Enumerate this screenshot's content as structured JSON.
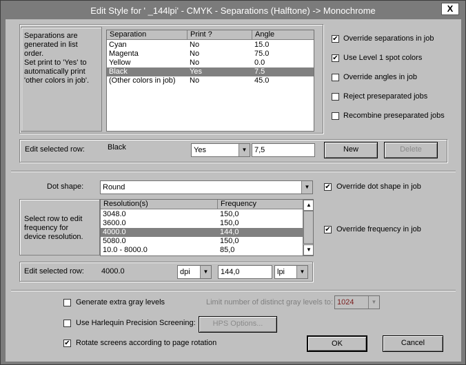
{
  "window": {
    "title": "Edit Style for '            _144lpi' - CMYK - Separations (Halftone) -> Monochrome",
    "close": "X"
  },
  "separations": {
    "info": [
      "Separations are",
      "generated in list",
      "order.",
      "Set print to 'Yes' to",
      "automatically print",
      "'other colors in job'."
    ],
    "columns": [
      "Separation",
      "Print ?",
      "Angle"
    ],
    "rows": [
      {
        "name": "Cyan",
        "print": "No",
        "angle": "15.0"
      },
      {
        "name": "Magenta",
        "print": "No",
        "angle": "75.0"
      },
      {
        "name": "Yellow",
        "print": "No",
        "angle": "0.0"
      },
      {
        "name": "Black",
        "print": "Yes",
        "angle": "7.5"
      },
      {
        "name": "(Other colors in job)",
        "print": "No",
        "angle": "45.0"
      }
    ],
    "selected_index": 3
  },
  "options": [
    {
      "label": "Override separations in job",
      "checked": true
    },
    {
      "label": "Use Level 1 spot colors",
      "checked": true
    },
    {
      "label": "Override angles in job",
      "checked": false
    },
    {
      "label": "Reject preseparated jobs",
      "checked": false
    },
    {
      "label": "Recombine preseparated jobs",
      "checked": false
    }
  ],
  "edit_sep": {
    "label": "Edit selected row:",
    "name": "Black",
    "print_value": "Yes",
    "angle_value": "7,5",
    "new": "New",
    "delete": "Delete"
  },
  "dot": {
    "label": "Dot shape:",
    "value": "Round",
    "override_label": "Override dot shape in job",
    "override_checked": true
  },
  "freq": {
    "info": [
      "Select row to edit",
      "frequency for",
      "device resolution."
    ],
    "columns": [
      "Resolution(s)",
      "Frequency"
    ],
    "rows": [
      {
        "res": "3048.0",
        "freq": "150,0"
      },
      {
        "res": "3600.0",
        "freq": "150,0"
      },
      {
        "res": "4000.0",
        "freq": "144,0"
      },
      {
        "res": "5080.0",
        "freq": "150,0"
      },
      {
        "res": "10.0 - 8000.0",
        "freq": "85,0"
      }
    ],
    "selected_index": 2,
    "override_label": "Override frequency in job",
    "override_checked": true
  },
  "edit_freq": {
    "label": "Edit selected row:",
    "res": "4000.0",
    "unit1": "dpi",
    "freq_value": "144,0",
    "unit2": "lpi"
  },
  "bottom": {
    "extra_gray": {
      "label": "Generate extra gray levels",
      "checked": false
    },
    "limit_label": "Limit number of distinct gray levels to:",
    "limit_value": "1024",
    "hps": {
      "label": "Use Harlequin Precision Screening:",
      "checked": false
    },
    "hps_button": "HPS Options...",
    "rotate": {
      "label": "Rotate screens according to page rotation",
      "checked": true
    },
    "ok": "OK",
    "cancel": "Cancel"
  },
  "colors": {
    "selection": "#808080",
    "dialog": "#c0c0c0",
    "titlebar": "#7b7b7b"
  }
}
